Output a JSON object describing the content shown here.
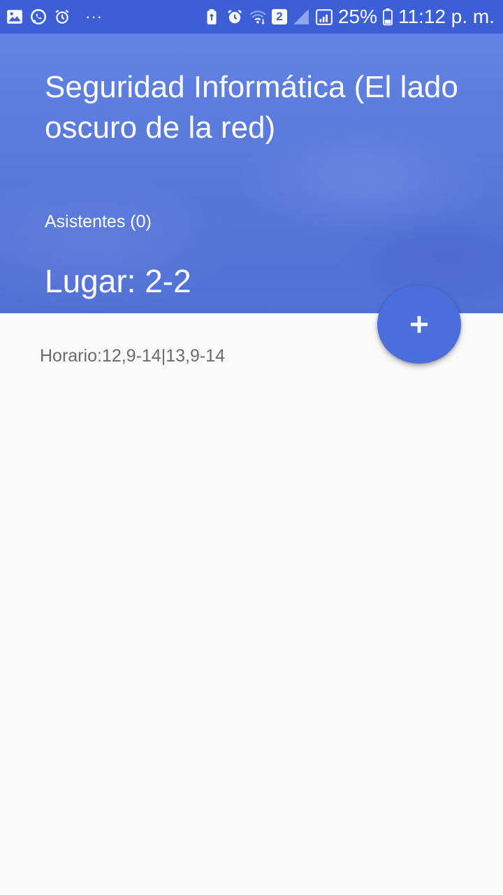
{
  "status_bar": {
    "left_icons": [
      "gallery-icon",
      "whatsapp-icon",
      "alarm-icon"
    ],
    "more_indicator": "···",
    "sim_label": "2",
    "battery_text": "25%",
    "time_text": "11:12 p. m."
  },
  "header": {
    "title": "Seguridad Informática (El lado oscuro de la red)",
    "attendees": "Asistentes (0)",
    "place": "Lugar: 2-2",
    "background_color": "#5777da"
  },
  "content": {
    "schedule": "Horario:12,9-14|13,9-14"
  },
  "fab": {
    "icon": "plus-icon",
    "color": "#4a6fdc"
  },
  "colors": {
    "status_bar": "#3c5fd6",
    "page_background": "#fafafa",
    "text_secondary": "#6b6b6b"
  }
}
